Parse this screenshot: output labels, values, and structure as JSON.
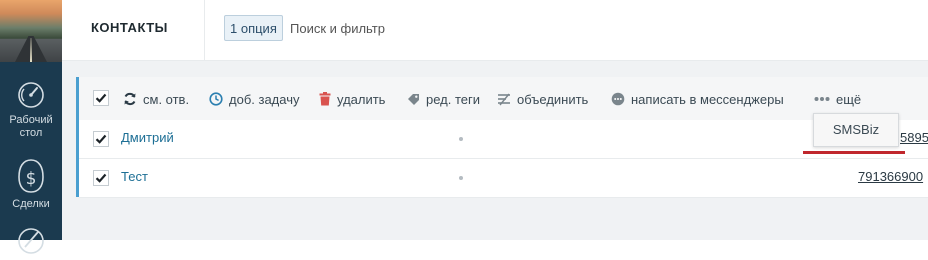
{
  "sidebar": {
    "items": [
      {
        "label": "Рабочий стол",
        "icon": "dashboard-icon"
      },
      {
        "label": "Сделки",
        "icon": "dollar-icon"
      },
      {
        "label": "",
        "icon": "tasks-icon"
      }
    ]
  },
  "header": {
    "title": "КОНТАКТЫ",
    "filter_chip": "1 опция",
    "search_placeholder": "Поиск и фильтр"
  },
  "toolbar": {
    "actions": [
      {
        "label": "см. отв.",
        "icon": "refresh-icon"
      },
      {
        "label": "доб. задачу",
        "icon": "clock-icon"
      },
      {
        "label": "удалить",
        "icon": "trash-icon"
      },
      {
        "label": "ред. теги",
        "icon": "tag-icon"
      },
      {
        "label": "объединить",
        "icon": "merge-icon"
      },
      {
        "label": "написать в мессенджеры",
        "icon": "chat-icon"
      },
      {
        "label": "ещё",
        "icon": "more-dots-icon"
      }
    ]
  },
  "rows": [
    {
      "name": "Дмитрий",
      "phone": "5895",
      "checked": true
    },
    {
      "name": "Тест",
      "phone": "791366900",
      "checked": true
    }
  ],
  "dropdown": {
    "items": [
      "SMSBiz"
    ]
  },
  "colors": {
    "sidebar_bg": "#1b3a4f",
    "accent": "#4a9fd0",
    "link": "#1d6f95",
    "highlight_underline": "#c0272d"
  }
}
